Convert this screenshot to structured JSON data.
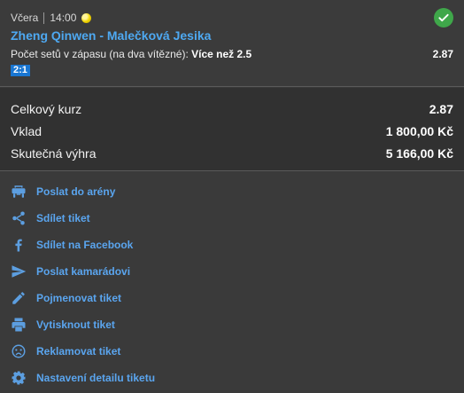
{
  "bet": {
    "day": "Včera",
    "time": "14:00",
    "sport_icon": "tennis-ball-icon",
    "status_icon": "check-circle-icon",
    "status_color": "#3fa74a",
    "match": "Zheng Qinwen - Malečková Jesika",
    "market_label": "Počet setů v zápasu (na dva vítězné):",
    "selection": "Více než 2.5",
    "odds": "2.87",
    "result": "2:1"
  },
  "summary": {
    "rows": [
      {
        "label": "Celkový kurz",
        "value": "2.87"
      },
      {
        "label": "Vklad",
        "value": "1 800,00 Kč"
      },
      {
        "label": "Skutečná výhra",
        "value": "5 166,00 Kč"
      }
    ]
  },
  "actions": [
    {
      "label": "Poslat do arény",
      "icon": "arena-icon"
    },
    {
      "label": "Sdílet tiket",
      "icon": "share-icon"
    },
    {
      "label": "Sdílet na Facebook",
      "icon": "facebook-icon"
    },
    {
      "label": "Poslat kamarádovi",
      "icon": "send-icon"
    },
    {
      "label": "Pojmenovat tiket",
      "icon": "pencil-icon"
    },
    {
      "label": "Vytisknout tiket",
      "icon": "printer-icon"
    },
    {
      "label": "Reklamovat tiket",
      "icon": "sad-face-icon"
    },
    {
      "label": "Nastavení detailu tiketu",
      "icon": "gear-icon"
    }
  ],
  "colors": {
    "link": "#5aa5ef",
    "badge": "#1976d2",
    "background": "#3a3a3a"
  }
}
